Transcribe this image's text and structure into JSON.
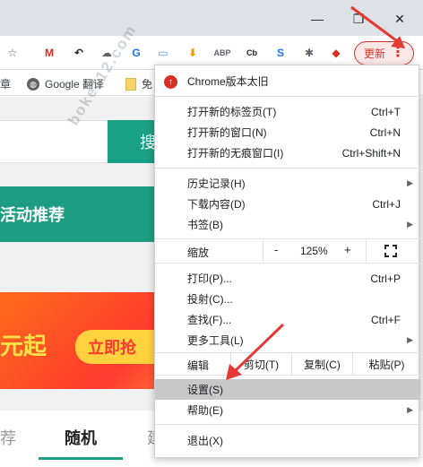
{
  "window": {
    "minimize": "—",
    "maximize": "❐",
    "close": "✕"
  },
  "toolbar": {
    "extensions": [
      {
        "name": "star-icon",
        "glyph": "☆",
        "color": "#5f6368"
      },
      {
        "name": "gmail-icon",
        "glyph": "M",
        "color": "#d93025"
      },
      {
        "name": "undo-extension-icon",
        "glyph": "↶",
        "color": "#202124"
      },
      {
        "name": "chat-extension-icon",
        "glyph": "☁",
        "color": "#5f6368"
      },
      {
        "name": "translate-extension-icon",
        "glyph": "G",
        "color": "#1a73e8"
      },
      {
        "name": "folder-extension-icon",
        "glyph": "▭",
        "color": "#5f9ad3"
      },
      {
        "name": "download-extension-icon",
        "glyph": "⬇",
        "color": "#f29900"
      },
      {
        "name": "adblock-plus-icon",
        "glyph": "ABP",
        "color": "#5f6368"
      },
      {
        "name": "cb-extension-icon",
        "glyph": "Cb",
        "color": "#202124"
      },
      {
        "name": "s-extension-icon",
        "glyph": "S",
        "color": "#1a73e8"
      },
      {
        "name": "puzzle-extensions-icon",
        "glyph": "✱",
        "color": "#5f6368"
      },
      {
        "name": "red-extension-icon",
        "glyph": "◆",
        "color": "#d93025"
      }
    ],
    "update_label": "更新",
    "menu_dots": "⋮"
  },
  "bookmarks": {
    "items": [
      {
        "label": "章"
      },
      {
        "label": "Google 翻译"
      },
      {
        "label": "免"
      }
    ]
  },
  "page": {
    "search_label": "搜",
    "activity_heading": "活动推荐",
    "promo_text": "元起",
    "promo_button": "立即抢",
    "tabs": [
      "荐",
      "随机",
      "建"
    ]
  },
  "watermark": "boke112.com",
  "menu": {
    "update_notice": "Chrome版本太旧",
    "items": [
      {
        "label": "打开新的标签页(T)",
        "shortcut": "Ctrl+T"
      },
      {
        "label": "打开新的窗口(N)",
        "shortcut": "Ctrl+N"
      },
      {
        "label": "打开新的无痕窗口(I)",
        "shortcut": "Ctrl+Shift+N"
      },
      {
        "label": "历史记录(H)",
        "shortcut": ""
      },
      {
        "label": "下载内容(D)",
        "shortcut": "Ctrl+J"
      },
      {
        "label": "书签(B)",
        "shortcut": ""
      },
      {
        "label": "打印(P)...",
        "shortcut": "Ctrl+P"
      },
      {
        "label": "投射(C)...",
        "shortcut": ""
      },
      {
        "label": "查找(F)...",
        "shortcut": "Ctrl+F"
      },
      {
        "label": "更多工具(L)",
        "shortcut": ""
      },
      {
        "label": "设置(S)",
        "shortcut": ""
      },
      {
        "label": "帮助(E)",
        "shortcut": ""
      },
      {
        "label": "退出(X)",
        "shortcut": ""
      }
    ],
    "zoom": {
      "label": "缩放",
      "minus": "-",
      "value": "125%",
      "plus": "+"
    },
    "edit": {
      "label": "编辑",
      "cut": "剪切(T)",
      "copy": "复制(C)",
      "paste": "粘贴(P)"
    }
  },
  "colors": {
    "accent": "#1aa084",
    "update": "#d93025",
    "highlight": "#c8c8c8"
  }
}
